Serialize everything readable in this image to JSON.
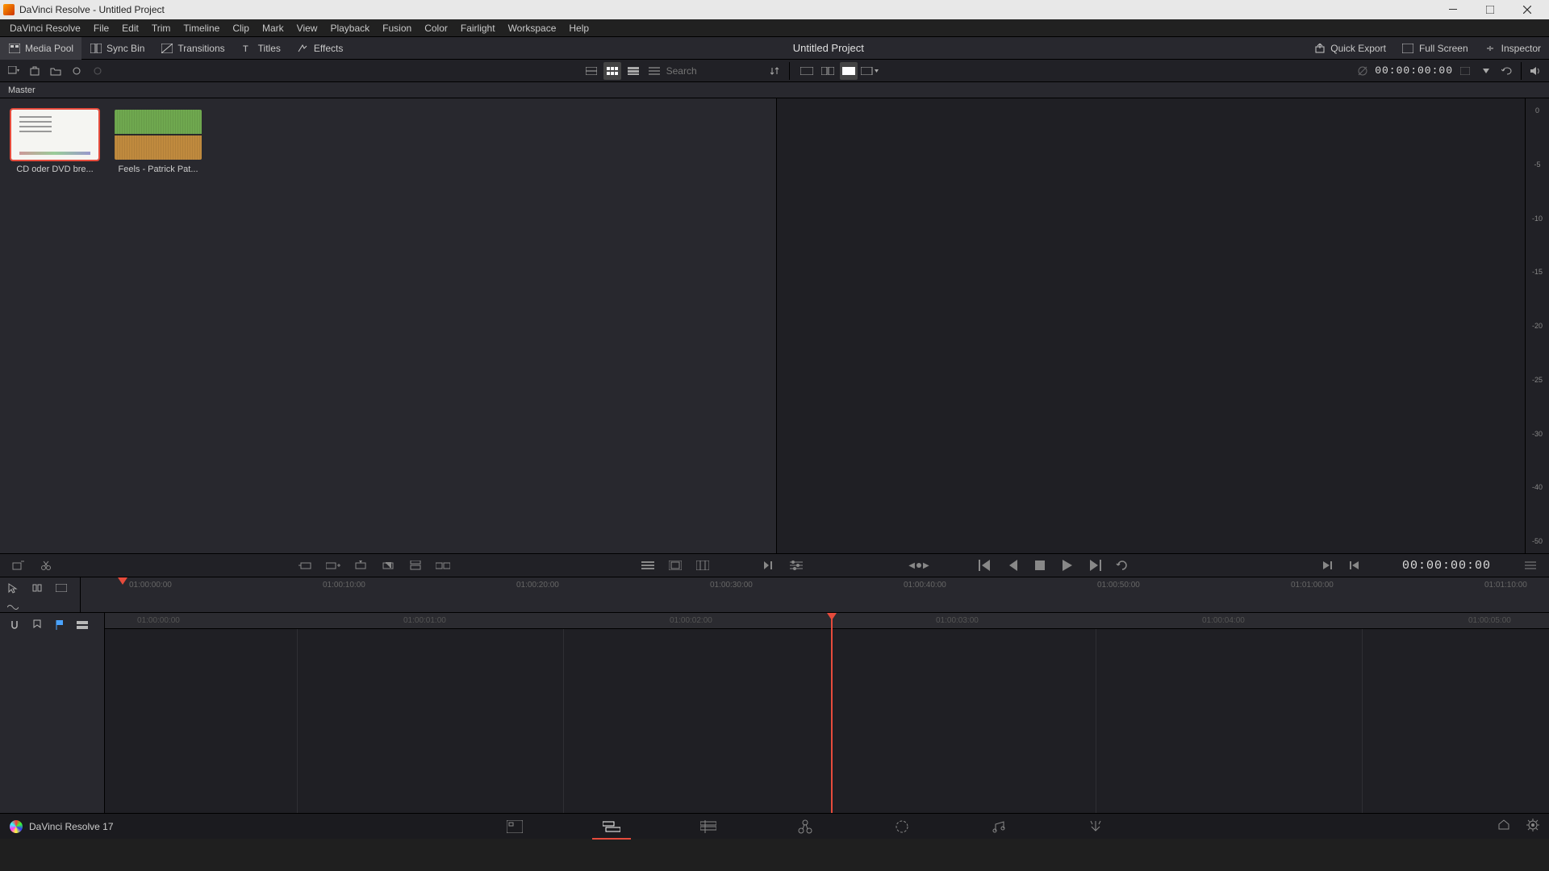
{
  "window": {
    "title": "DaVinci Resolve - Untitled Project"
  },
  "menus": [
    "DaVinci Resolve",
    "File",
    "Edit",
    "Trim",
    "Timeline",
    "Clip",
    "Mark",
    "View",
    "Playback",
    "Fusion",
    "Color",
    "Fairlight",
    "Workspace",
    "Help"
  ],
  "toolbar_panels": {
    "media_pool": "Media Pool",
    "sync_bin": "Sync Bin",
    "transitions": "Transitions",
    "titles": "Titles",
    "effects": "Effects"
  },
  "project_title": "Untitled Project",
  "toolbar_right": {
    "quick_export": "Quick Export",
    "full_screen": "Full Screen",
    "inspector": "Inspector"
  },
  "subtool": {
    "search_placeholder": "Search",
    "viewer_timecode": "00:00:00:00"
  },
  "bin_label": "Master",
  "clips": [
    {
      "name": "CD oder DVD bre...",
      "kind": "image",
      "selected": true
    },
    {
      "name": "Feels - Patrick Pat...",
      "kind": "audio",
      "selected": false
    }
  ],
  "audiometer_ticks": [
    "0",
    "-5",
    "-10",
    "-15",
    "-20",
    "-25",
    "-30",
    "-40",
    "-50"
  ],
  "midtool": {
    "timecode": "00:00:00:00"
  },
  "timeline_ruler_ticks": [
    "01:00:00:00",
    "01:00:10:00",
    "01:00:20:00",
    "01:00:30:00",
    "01:00:40:00",
    "01:00:50:00",
    "01:01:00:00",
    "01:01:10:00"
  ],
  "timeline_ruler2_ticks": [
    "01:00:00:00",
    "01:00:01:00",
    "01:00:02:00",
    "01:00:03:00",
    "01:00:04:00",
    "01:00:05:00"
  ],
  "footer": {
    "brand": "DaVinci Resolve 17"
  }
}
